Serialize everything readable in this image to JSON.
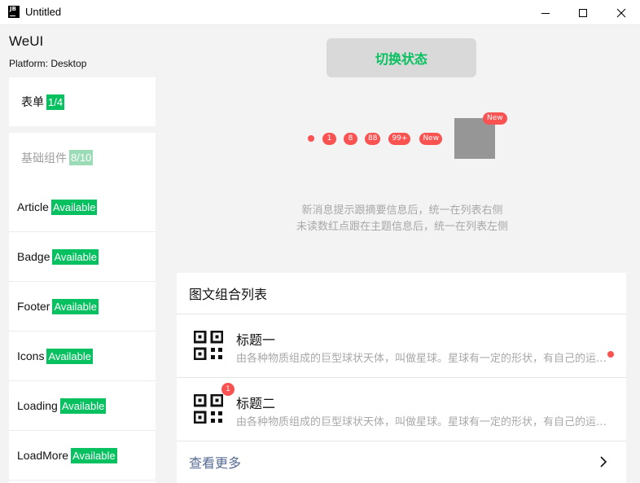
{
  "window": {
    "title": "Untitled",
    "app_icon_text": "JB",
    "controls": [
      "minimize",
      "maximize",
      "close"
    ]
  },
  "sidebar": {
    "brand": "WeUI",
    "platform": "Platform: Desktop",
    "groups": [
      {
        "label": "表单",
        "count": "1/4"
      },
      {
        "label": "基础组件",
        "count": "8/10"
      }
    ],
    "items": [
      {
        "label": "Article",
        "status": "Available"
      },
      {
        "label": "Badge",
        "status": "Available"
      },
      {
        "label": "Footer",
        "status": "Available"
      },
      {
        "label": "Icons",
        "status": "Available"
      },
      {
        "label": "Loading",
        "status": "Available"
      },
      {
        "label": "LoadMore",
        "status": "Available"
      }
    ]
  },
  "main": {
    "toggle_button": "切换状态",
    "badges": [
      "1",
      "8",
      "88",
      "99+",
      "New"
    ],
    "square_badge": "New",
    "hints": [
      "新消息提示跟摘要信息后，统一在列表右侧",
      "未读数红点跟在主题信息后，统一在列表左侧"
    ],
    "panel": {
      "title": "图文组合列表",
      "items": [
        {
          "title": "标题一",
          "desc": "由各种物质组成的巨型球状天体，叫做星球。星球有一定的形状，有自己的运行轨道。"
        },
        {
          "title": "标题二",
          "desc": "由各种物质组成的巨型球状天体，叫做星球。星球有一定的形状，有自己的运行轨道。",
          "badge": "1"
        }
      ],
      "more_label": "查看更多"
    }
  },
  "colors": {
    "accent": "#07c160",
    "accent_light": "#9bdcb7",
    "badge_red": "#fa5151",
    "link_blue": "#576b95",
    "hint_gray": "#a8a8a8"
  }
}
